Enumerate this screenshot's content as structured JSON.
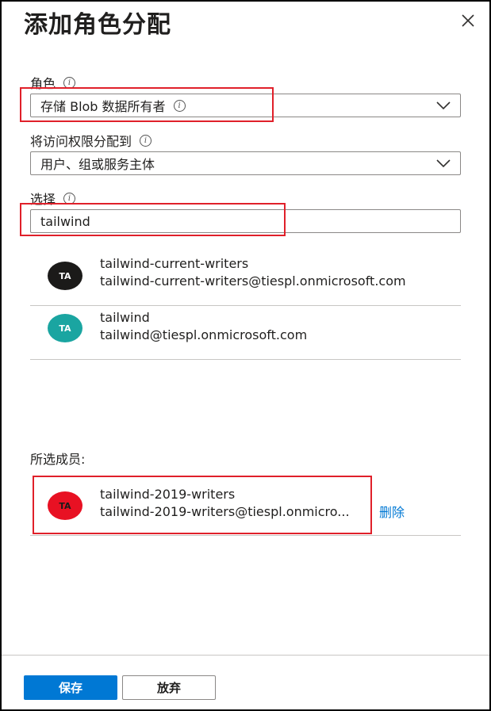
{
  "panel": {
    "title": "添加角色分配",
    "close_icon": "close-icon"
  },
  "role": {
    "label": "角色",
    "value": "存储 Blob 数据所有者"
  },
  "assign": {
    "label": "将访问权限分配到",
    "value": "用户、组或服务主体"
  },
  "select": {
    "label": "选择",
    "value": "tailwind"
  },
  "results": [
    {
      "initials": "TA",
      "name": "tailwind-current-writers",
      "email": "tailwind-current-writers@tiespl.onmicrosoft.com",
      "color": "#1b1a19"
    },
    {
      "initials": "TA",
      "name": "tailwind",
      "email": "tailwind@tiespl.onmicrosoft.com",
      "color": "#1aa5a1"
    }
  ],
  "selected": {
    "label": "所选成员:",
    "members": [
      {
        "initials": "TA",
        "name": "tailwind-2019-writers",
        "email": "tailwind-2019-writers@tiespl.onmicro...",
        "color": "#e81123",
        "remove_label": "删除"
      }
    ]
  },
  "footer": {
    "save_label": "保存",
    "discard_label": "放弃"
  },
  "colors": {
    "accent": "#0078d4",
    "highlight": "#e0202a"
  }
}
